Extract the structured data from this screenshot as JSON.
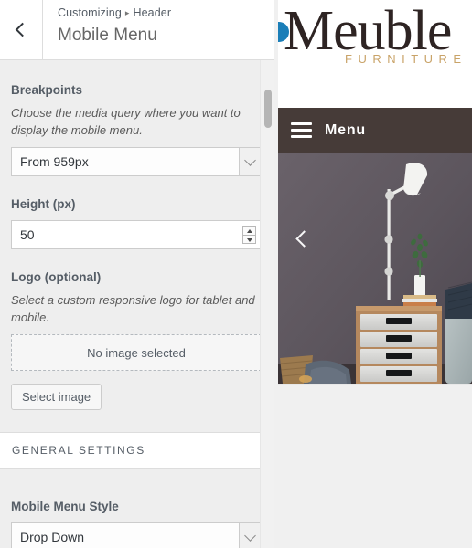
{
  "customizer": {
    "back_button_icon": "chevron-left-icon",
    "breadcrumb": {
      "root": "Customizing",
      "separator": "▸",
      "current": "Header"
    },
    "panel_title": "Mobile Menu",
    "controls": {
      "breakpoints": {
        "label": "Breakpoints",
        "description": "Choose the media query where you want to display the mobile menu.",
        "selected": "From 959px"
      },
      "height": {
        "label": "Height (px)",
        "value": "50"
      },
      "logo": {
        "label": "Logo (optional)",
        "description": "Select a custom responsive logo for tablet and mobile.",
        "placeholder": "No image selected",
        "button": "Select image"
      }
    },
    "general_settings": {
      "heading": "GENERAL SETTINGS",
      "mobile_menu_style": {
        "label": "Mobile Menu Style",
        "selected": "Drop Down"
      }
    }
  },
  "preview": {
    "site_logo": {
      "name": "Meuble",
      "tagline": "FURNITURE",
      "name_color": "#2e2423",
      "tagline_color": "#c9a368"
    },
    "mobile_menu": {
      "icon": "hamburger-icon",
      "label": "Menu",
      "bar_color": "#463b38"
    },
    "hero": {
      "prev_arrow_icon": "chevron-left-icon",
      "wall_color": "#5b545c",
      "alt": "Bedroom interior with white desk lamp, potted plant and chest of drawers"
    }
  }
}
